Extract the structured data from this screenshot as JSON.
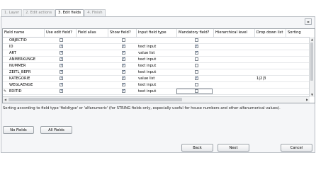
{
  "tabs": [
    {
      "label": "1. Layer",
      "active": false
    },
    {
      "label": "2. Edit actions",
      "active": false
    },
    {
      "label": "3. Edit fields",
      "active": true
    },
    {
      "label": "4. Finish",
      "active": false
    }
  ],
  "grid": {
    "columns": [
      "Field name",
      "Use edit field?",
      "Field alias",
      "Show field?",
      "Input field type",
      "Mandatory field?",
      "Hierarchical level",
      "Drop down list",
      "Sorting"
    ],
    "rows": [
      {
        "name": "OBJECTID",
        "use": false,
        "alias": "",
        "show": false,
        "type": "",
        "mandatory": false,
        "level": "",
        "dropdown": "",
        "sorting": ""
      },
      {
        "name": "ID",
        "use": true,
        "alias": "",
        "show": true,
        "type": "text input",
        "mandatory": true,
        "level": "",
        "dropdown": "",
        "sorting": ""
      },
      {
        "name": "ART",
        "use": true,
        "alias": "",
        "show": true,
        "type": "value list",
        "mandatory": true,
        "level": "",
        "dropdown": "",
        "sorting": ""
      },
      {
        "name": "ANMERKUNGE",
        "use": true,
        "alias": "",
        "show": true,
        "type": "text input",
        "mandatory": false,
        "level": "",
        "dropdown": "",
        "sorting": ""
      },
      {
        "name": "NUMMER",
        "use": true,
        "alias": "",
        "show": true,
        "type": "text input",
        "mandatory": false,
        "level": "",
        "dropdown": "",
        "sorting": ""
      },
      {
        "name": "ZEITL_BEFR",
        "use": true,
        "alias": "",
        "show": true,
        "type": "text input",
        "mandatory": false,
        "level": "",
        "dropdown": "",
        "sorting": ""
      },
      {
        "name": "KATEGORIE",
        "use": true,
        "alias": "",
        "show": true,
        "type": "value list",
        "mandatory": true,
        "level": "",
        "dropdown": "1|2|3",
        "sorting": ""
      },
      {
        "name": "WEGLAENGE",
        "use": true,
        "alias": "",
        "show": true,
        "type": "text input",
        "mandatory": false,
        "level": "",
        "dropdown": "",
        "sorting": ""
      },
      {
        "name": "EDITID",
        "use": true,
        "alias": "",
        "show": true,
        "type": "text input",
        "mandatory": false,
        "level": "",
        "dropdown": "",
        "sorting": "",
        "current": true
      }
    ]
  },
  "note": "Sorting according to field type 'fieldtype' or 'alfanumeric' (for STRING fields only, especially useful for house numbers and other alfanumerical values).",
  "buttons": {
    "no_fields": "No Fields",
    "all_fields": "All Fields",
    "back": "Back",
    "next": "Next",
    "cancel": "Cancel"
  },
  "icons": {
    "row_indicator": "pencil-arrow-icon",
    "tab_scroll": "chevron-left-right-icon"
  },
  "colors": {
    "panel_bg": "#f5f6f8",
    "check": "#1c3f74"
  }
}
